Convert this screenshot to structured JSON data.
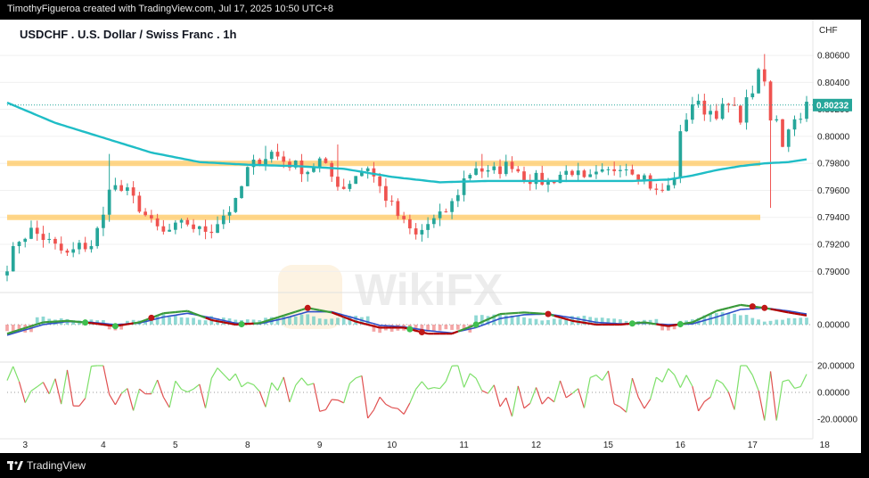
{
  "header": {
    "attribution": "TimothyFigueroa created with TradingView.com, Jul 17, 2025 10:50 UTC+8"
  },
  "footer": {
    "brand": "TradingView",
    "logo_icon": "tradingview-logo-icon"
  },
  "watermark": {
    "text": "WikiFX"
  },
  "colors": {
    "up": "#26a69a",
    "down": "#ef5350",
    "ma": "#1fbdc6",
    "zone": "#ffc860",
    "macd_fast": "#3a9a3a",
    "macd_slow": "#3050c8",
    "macd_red": "#b00000",
    "osc_up": "#7ee06a",
    "osc_down": "#e05050"
  },
  "chart_data": {
    "type": "candlestick",
    "title": "USDCHF . U.S. Dollar / Swiss Franc . 1h",
    "currency": "CHF",
    "last_price": "0.80232",
    "last_price_value": 0.80232,
    "price_axis": {
      "ylim": [
        0.7885,
        0.8068
      ],
      "ticks": [
        "0.80600",
        "0.80400",
        "0.80200",
        "0.80000",
        "0.79800",
        "0.79600",
        "0.79400",
        "0.79200",
        "0.79000"
      ],
      "tick_values": [
        0.806,
        0.804,
        0.802,
        0.8,
        0.798,
        0.796,
        0.794,
        0.792,
        0.79
      ]
    },
    "x_axis": {
      "labels": [
        "3",
        "4",
        "5",
        "8",
        "9",
        "10",
        "11",
        "12",
        "15",
        "16",
        "17",
        "18"
      ],
      "label_index": [
        3,
        16,
        28,
        40,
        52,
        64,
        76,
        88,
        100,
        112,
        124,
        136
      ]
    },
    "zones": [
      {
        "name": "resistance",
        "low": 0.7978,
        "high": 0.7982
      },
      {
        "name": "support",
        "low": 0.7938,
        "high": 0.7942
      }
    ],
    "moving_average": {
      "type": "line",
      "x": [
        0,
        8,
        16,
        24,
        32,
        40,
        48,
        56,
        64,
        72,
        80,
        88,
        96,
        104,
        110,
        114,
        118,
        122,
        126,
        130,
        133
      ],
      "y": [
        0.8025,
        0.801,
        0.7999,
        0.7988,
        0.7981,
        0.7979,
        0.7978,
        0.7976,
        0.797,
        0.7966,
        0.7967,
        0.7967,
        0.7967,
        0.7967,
        0.7968,
        0.7971,
        0.7975,
        0.7978,
        0.798,
        0.7981,
        0.7983
      ]
    },
    "series": [
      {
        "ohlc_waypoints": {
          "x": [
            0,
            2,
            4,
            6,
            8,
            10,
            12,
            14,
            16,
            17,
            18,
            20,
            22,
            24,
            26,
            28,
            30,
            32,
            34,
            36,
            38,
            40,
            42,
            44,
            46,
            48,
            50,
            52,
            54,
            56,
            58,
            60,
            62,
            64,
            66,
            68,
            70,
            72,
            74,
            76,
            78,
            80,
            82,
            84,
            86,
            88,
            90,
            92,
            94,
            96,
            98,
            100,
            102,
            104,
            106,
            108,
            110,
            111,
            112,
            113,
            114,
            116,
            118,
            120,
            122,
            124,
            125,
            126,
            127,
            128,
            129,
            130,
            131,
            133
          ],
          "y": [
            0.7905,
            0.7924,
            0.793,
            0.7925,
            0.7918,
            0.7912,
            0.7918,
            0.792,
            0.794,
            0.7965,
            0.7962,
            0.7958,
            0.7948,
            0.7935,
            0.7928,
            0.7932,
            0.7936,
            0.793,
            0.7932,
            0.7942,
            0.795,
            0.7975,
            0.7983,
            0.7988,
            0.7982,
            0.7978,
            0.7975,
            0.7982,
            0.797,
            0.7962,
            0.7972,
            0.7978,
            0.7962,
            0.7948,
            0.7935,
            0.7926,
            0.7935,
            0.794,
            0.795,
            0.7968,
            0.7978,
            0.7972,
            0.7976,
            0.798,
            0.797,
            0.7968,
            0.7966,
            0.7972,
            0.7975,
            0.7966,
            0.797,
            0.7973,
            0.798,
            0.7976,
            0.797,
            0.7958,
            0.7962,
            0.7972,
            0.8,
            0.8015,
            0.8025,
            0.802,
            0.8018,
            0.8022,
            0.8015,
            0.8035,
            0.8045,
            0.804,
            0.801,
            0.8015,
            0.7995,
            0.8008,
            0.8012,
            0.8023
          ]
        },
        "notable_wicks": [
          {
            "x": 17,
            "high": 0.7987
          },
          {
            "x": 43,
            "high": 0.7993
          },
          {
            "x": 55,
            "high": 0.7994
          },
          {
            "x": 79,
            "high": 0.7987
          },
          {
            "x": 126,
            "high": 0.8061
          },
          {
            "x": 127,
            "low": 0.7947
          }
        ]
      }
    ],
    "indicators": [
      {
        "name": "macd",
        "zero_label": "0.00000",
        "fast": {
          "x": [
            0,
            6,
            10,
            14,
            18,
            22,
            26,
            30,
            34,
            38,
            42,
            46,
            50,
            54,
            58,
            62,
            66,
            70,
            74,
            78,
            82,
            86,
            90,
            94,
            98,
            102,
            106,
            110,
            114,
            118,
            122,
            126,
            130,
            133
          ],
          "y": [
            -12,
            3,
            5,
            2,
            -2,
            3,
            15,
            18,
            6,
            0,
            2,
            12,
            22,
            16,
            4,
            -4,
            -4,
            -12,
            -12,
            0,
            14,
            16,
            14,
            5,
            0,
            0,
            3,
            -2,
            3,
            18,
            26,
            22,
            16,
            12
          ]
        },
        "slow": {
          "x": [
            0,
            6,
            10,
            14,
            18,
            22,
            26,
            30,
            34,
            38,
            42,
            46,
            50,
            54,
            58,
            62,
            66,
            70,
            74,
            78,
            82,
            86,
            90,
            94,
            98,
            102,
            106,
            110,
            114,
            118,
            122,
            126,
            130,
            133
          ],
          "y": [
            -14,
            0,
            4,
            3,
            0,
            2,
            10,
            15,
            9,
            2,
            1,
            8,
            17,
            17,
            8,
            -1,
            -3,
            -8,
            -11,
            -4,
            8,
            13,
            14,
            9,
            3,
            1,
            2,
            0,
            1,
            10,
            20,
            22,
            18,
            14
          ]
        },
        "markers": [
          {
            "x": 13,
            "color": "green"
          },
          {
            "x": 18,
            "color": "green"
          },
          {
            "x": 24,
            "color": "red"
          },
          {
            "x": 39,
            "color": "green"
          },
          {
            "x": 50,
            "color": "red"
          },
          {
            "x": 67,
            "color": "green"
          },
          {
            "x": 69,
            "color": "red"
          },
          {
            "x": 78,
            "color": "green"
          },
          {
            "x": 90,
            "color": "red"
          },
          {
            "x": 104,
            "color": "green"
          },
          {
            "x": 112,
            "color": "green"
          },
          {
            "x": 124,
            "color": "red"
          },
          {
            "x": 126,
            "color": "red"
          }
        ]
      },
      {
        "name": "oscillator",
        "ticks": [
          "20.00000",
          "0.00000",
          "-20.00000"
        ],
        "tick_values": [
          20,
          0,
          -20
        ],
        "ylim": [
          -25,
          25
        ]
      }
    ]
  }
}
